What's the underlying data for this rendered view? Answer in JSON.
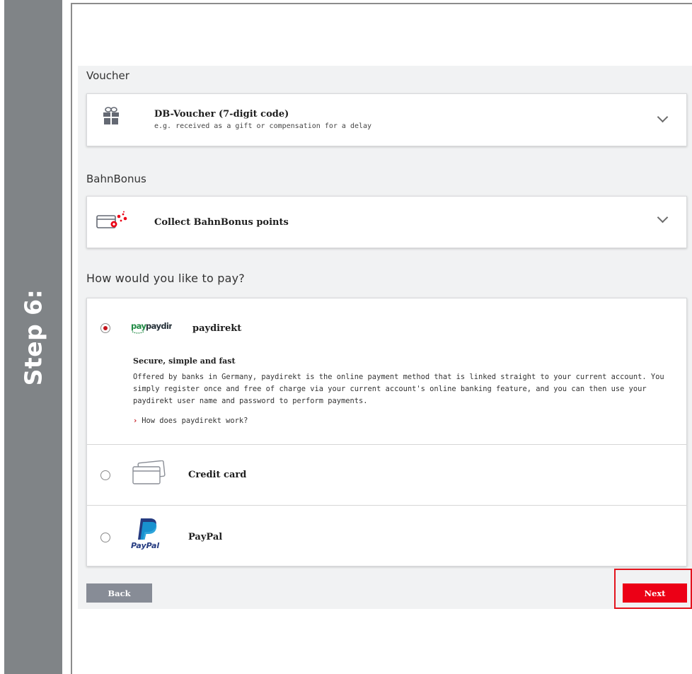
{
  "step": {
    "label": "Step 6:"
  },
  "voucher": {
    "heading": "Voucher",
    "title": "DB-Voucher (7-digit code)",
    "subtitle": "e.g. received as a gift or compensation for a delay"
  },
  "bahnbonus": {
    "heading": "BahnBonus",
    "title": "Collect BahnBonus points"
  },
  "payment": {
    "heading": "How would you like to pay?",
    "options": [
      {
        "name": "paydirekt",
        "logo_text": "paydirekt",
        "selected": true,
        "subheading": "Secure, simple and fast",
        "description": "Offered by banks in Germany, paydirekt is the online payment method that is linked straight to your current account. You simply register once and free of charge via your current account's online banking feature, and you can then use your paydirekt user name and password to perform payments.",
        "link": "How does paydirekt work?"
      },
      {
        "name": "Credit card",
        "selected": false
      },
      {
        "name": "PayPal",
        "logo_text": "PayPal",
        "selected": false
      }
    ]
  },
  "buttons": {
    "back": "Back",
    "next": "Next"
  },
  "colors": {
    "brand_red": "#ec0016",
    "step_bar": "#808487",
    "back_button": "#878c96"
  }
}
